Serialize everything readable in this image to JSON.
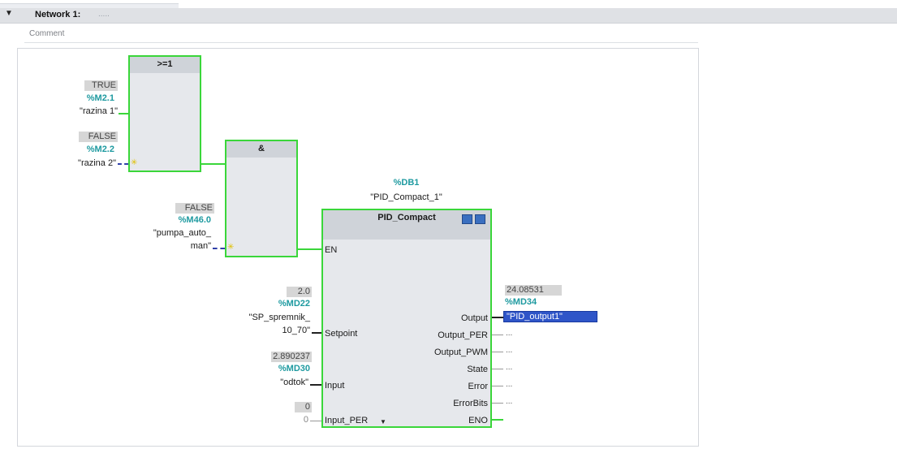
{
  "network": {
    "toggle": "▼",
    "title": "Network 1:",
    "title_dots": ".....",
    "comment": "Comment"
  },
  "or_block": {
    "title": ">=1",
    "in1": {
      "value": "TRUE",
      "address": "%M2.1",
      "tag": "\"razina 1\""
    },
    "in2": {
      "value": "FALSE",
      "address": "%M2.2",
      "tag": "\"razina 2\""
    }
  },
  "and_block": {
    "title": "&",
    "in2": {
      "value": "FALSE",
      "address": "%M46.0",
      "tag_line1": "\"pumpa_auto_",
      "tag_line2": "man\""
    }
  },
  "pid": {
    "db_address": "%DB1",
    "db_name": "\"PID_Compact_1\"",
    "title": "PID_Compact",
    "pins_left": {
      "en": "EN",
      "setpoint": "Setpoint",
      "input": "Input",
      "input_per": "Input_PER"
    },
    "pins_right": {
      "output": "Output",
      "output_per": "Output_PER",
      "output_pwm": "Output_PWM",
      "state": "State",
      "error": "Error",
      "errorbits": "ErrorBits",
      "eno": "ENO"
    },
    "setpoint": {
      "value": "2.0",
      "address": "%MD22",
      "tag_line1": "\"SP_spremnik_",
      "tag_line2": "10_70\""
    },
    "input": {
      "value": "2.890237",
      "address": "%MD30",
      "tag": "\"odtok\""
    },
    "input_per": {
      "value": "0",
      "const": "0"
    },
    "output": {
      "value": "24.08531",
      "address": "%MD34",
      "tag": "\"PID_output1\""
    },
    "unconnected": "...",
    "expand_icon": "chevron-down-icon"
  },
  "colors": {
    "wire_green": "#3ad63a",
    "address_teal": "#1e9aa0",
    "selection_blue": "#2f55c8"
  }
}
